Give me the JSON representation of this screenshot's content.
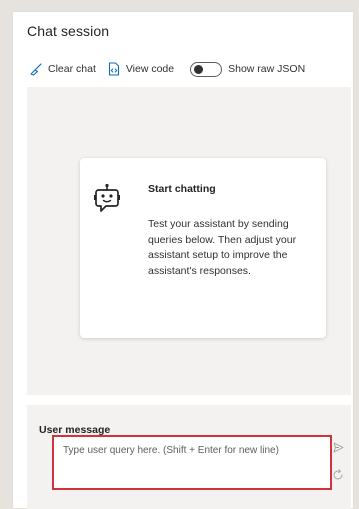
{
  "panel": {
    "title": "Chat session"
  },
  "toolbar": {
    "clear_chat_label": "Clear chat",
    "view_code_label": "View code",
    "show_raw_json_label": "Show raw JSON",
    "show_raw_json_on": false
  },
  "empty_state": {
    "icon": "bot-icon",
    "title": "Start chatting",
    "body": "Test your assistant by sending queries below. Then adjust your assistant setup to improve the assistant's responses."
  },
  "user_message": {
    "label": "User message",
    "placeholder": "Type user query here. (Shift + Enter for new line)",
    "value": ""
  },
  "colors": {
    "accent": "#0f6cbd",
    "highlight_border": "#d13438",
    "chat_background": "#f3f2f1"
  }
}
